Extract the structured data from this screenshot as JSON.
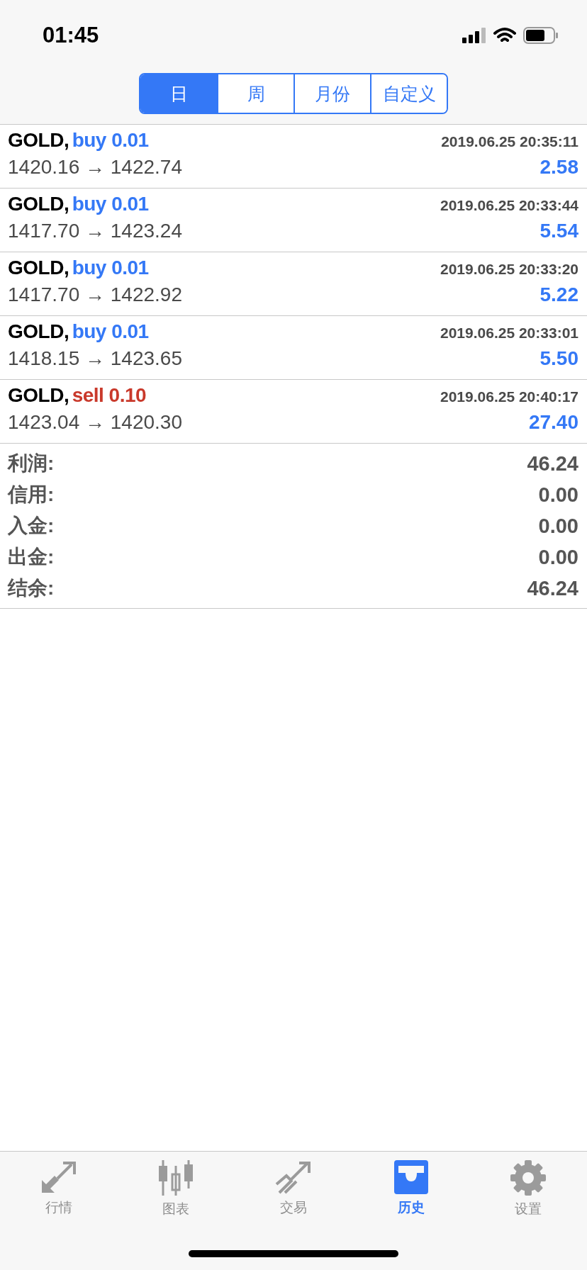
{
  "status_bar": {
    "time": "01:45"
  },
  "segments": [
    {
      "label": "日",
      "selected": true
    },
    {
      "label": "周",
      "selected": false
    },
    {
      "label": "月份",
      "selected": false
    },
    {
      "label": "自定义",
      "selected": false
    }
  ],
  "trades": [
    {
      "symbol": "GOLD,",
      "kind": "buy",
      "order": "buy 0.01",
      "time": "2019.06.25 20:35:11",
      "prices": "1420.16 → 1422.74",
      "profit": "2.58"
    },
    {
      "symbol": "GOLD,",
      "kind": "buy",
      "order": "buy 0.01",
      "time": "2019.06.25 20:33:44",
      "prices": "1417.70 → 1423.24",
      "profit": "5.54"
    },
    {
      "symbol": "GOLD,",
      "kind": "buy",
      "order": "buy 0.01",
      "time": "2019.06.25 20:33:20",
      "prices": "1417.70 → 1422.92",
      "profit": "5.22"
    },
    {
      "symbol": "GOLD,",
      "kind": "buy",
      "order": "buy 0.01",
      "time": "2019.06.25 20:33:01",
      "prices": "1418.15 → 1423.65",
      "profit": "5.50"
    },
    {
      "symbol": "GOLD,",
      "kind": "sell",
      "order": "sell 0.10",
      "time": "2019.06.25 20:40:17",
      "prices": "1423.04 → 1420.30",
      "profit": "27.40"
    }
  ],
  "summary": [
    {
      "label": "利润:",
      "value": "46.24"
    },
    {
      "label": "信用:",
      "value": "0.00"
    },
    {
      "label": "入金:",
      "value": "0.00"
    },
    {
      "label": "出金:",
      "value": "0.00"
    },
    {
      "label": "结余:",
      "value": "46.24"
    }
  ],
  "tab_bar": [
    {
      "label": "行情",
      "kind": "quotes",
      "selected": false
    },
    {
      "label": "图表",
      "kind": "chart",
      "selected": false
    },
    {
      "label": "交易",
      "kind": "trade",
      "selected": false
    },
    {
      "label": "历史",
      "kind": "history",
      "selected": true
    },
    {
      "label": "设置",
      "kind": "settings",
      "selected": false
    }
  ]
}
